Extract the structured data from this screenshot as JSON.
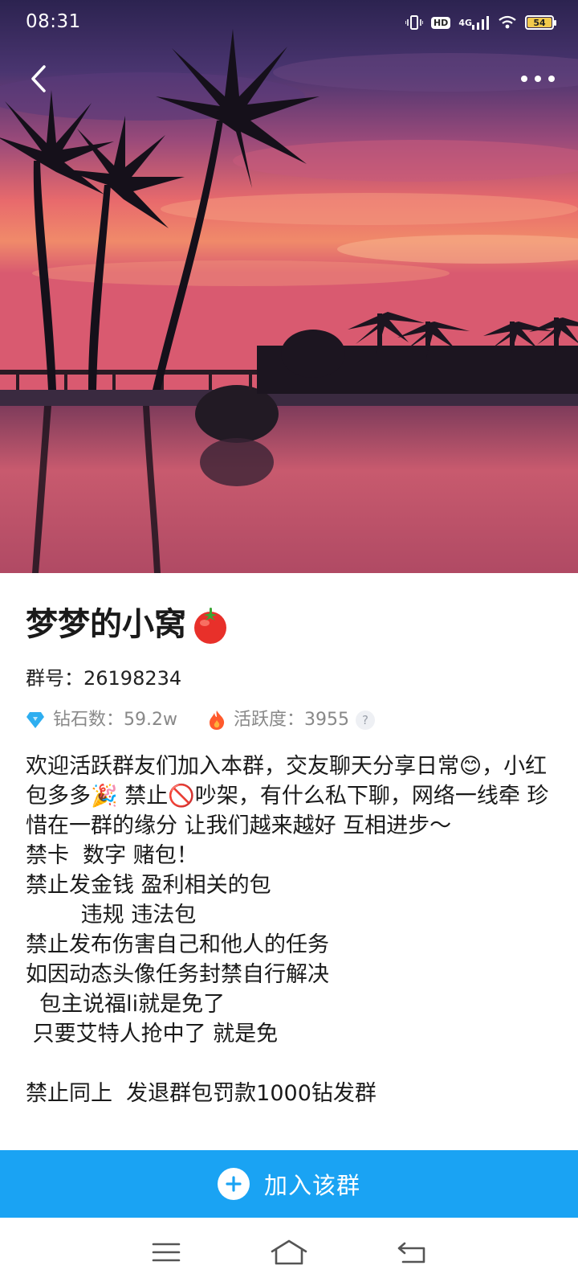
{
  "status_bar": {
    "time": "08:31",
    "hd": "HD",
    "network": "4G",
    "battery": "54"
  },
  "header": {
    "back_icon": "chevron-left-icon",
    "more_icon": "more-horizontal-icon"
  },
  "group": {
    "name": "梦梦的小窝",
    "name_emoji": "tomato-icon",
    "id_text": "群号：26198234",
    "diamonds_text": "钻石数：59.2w",
    "activity_text": "活跃度：3955",
    "help": "?",
    "description": "欢迎活跃群友们加入本群，交友聊天分享日常😊，小红包多多🎉 禁止🚫吵架，有什么私下聊，网络一线牵 珍惜在一群的缘分 让我们越来越好 互相进步～\n禁卡  数字 赌包！\n禁止发金钱 盈利相关的包\n        违规 违法包\n禁止发布伤害自己和他人的任务\n如因动态头像任务封禁自行解决\n  包主说福li就是免了\n 只要艾特人抢中了 就是免\n\n禁止同上  发退群包罚款1000钻发群"
  },
  "join": {
    "label": "加入该群",
    "icon": "plus-icon"
  },
  "nav": {
    "menu_icon": "menu-icon",
    "home_icon": "home-icon",
    "back_icon": "back-icon"
  },
  "colors": {
    "accent": "#1aa3f3",
    "diamond": "#2eaef0",
    "flame": "#ff5a2c"
  }
}
